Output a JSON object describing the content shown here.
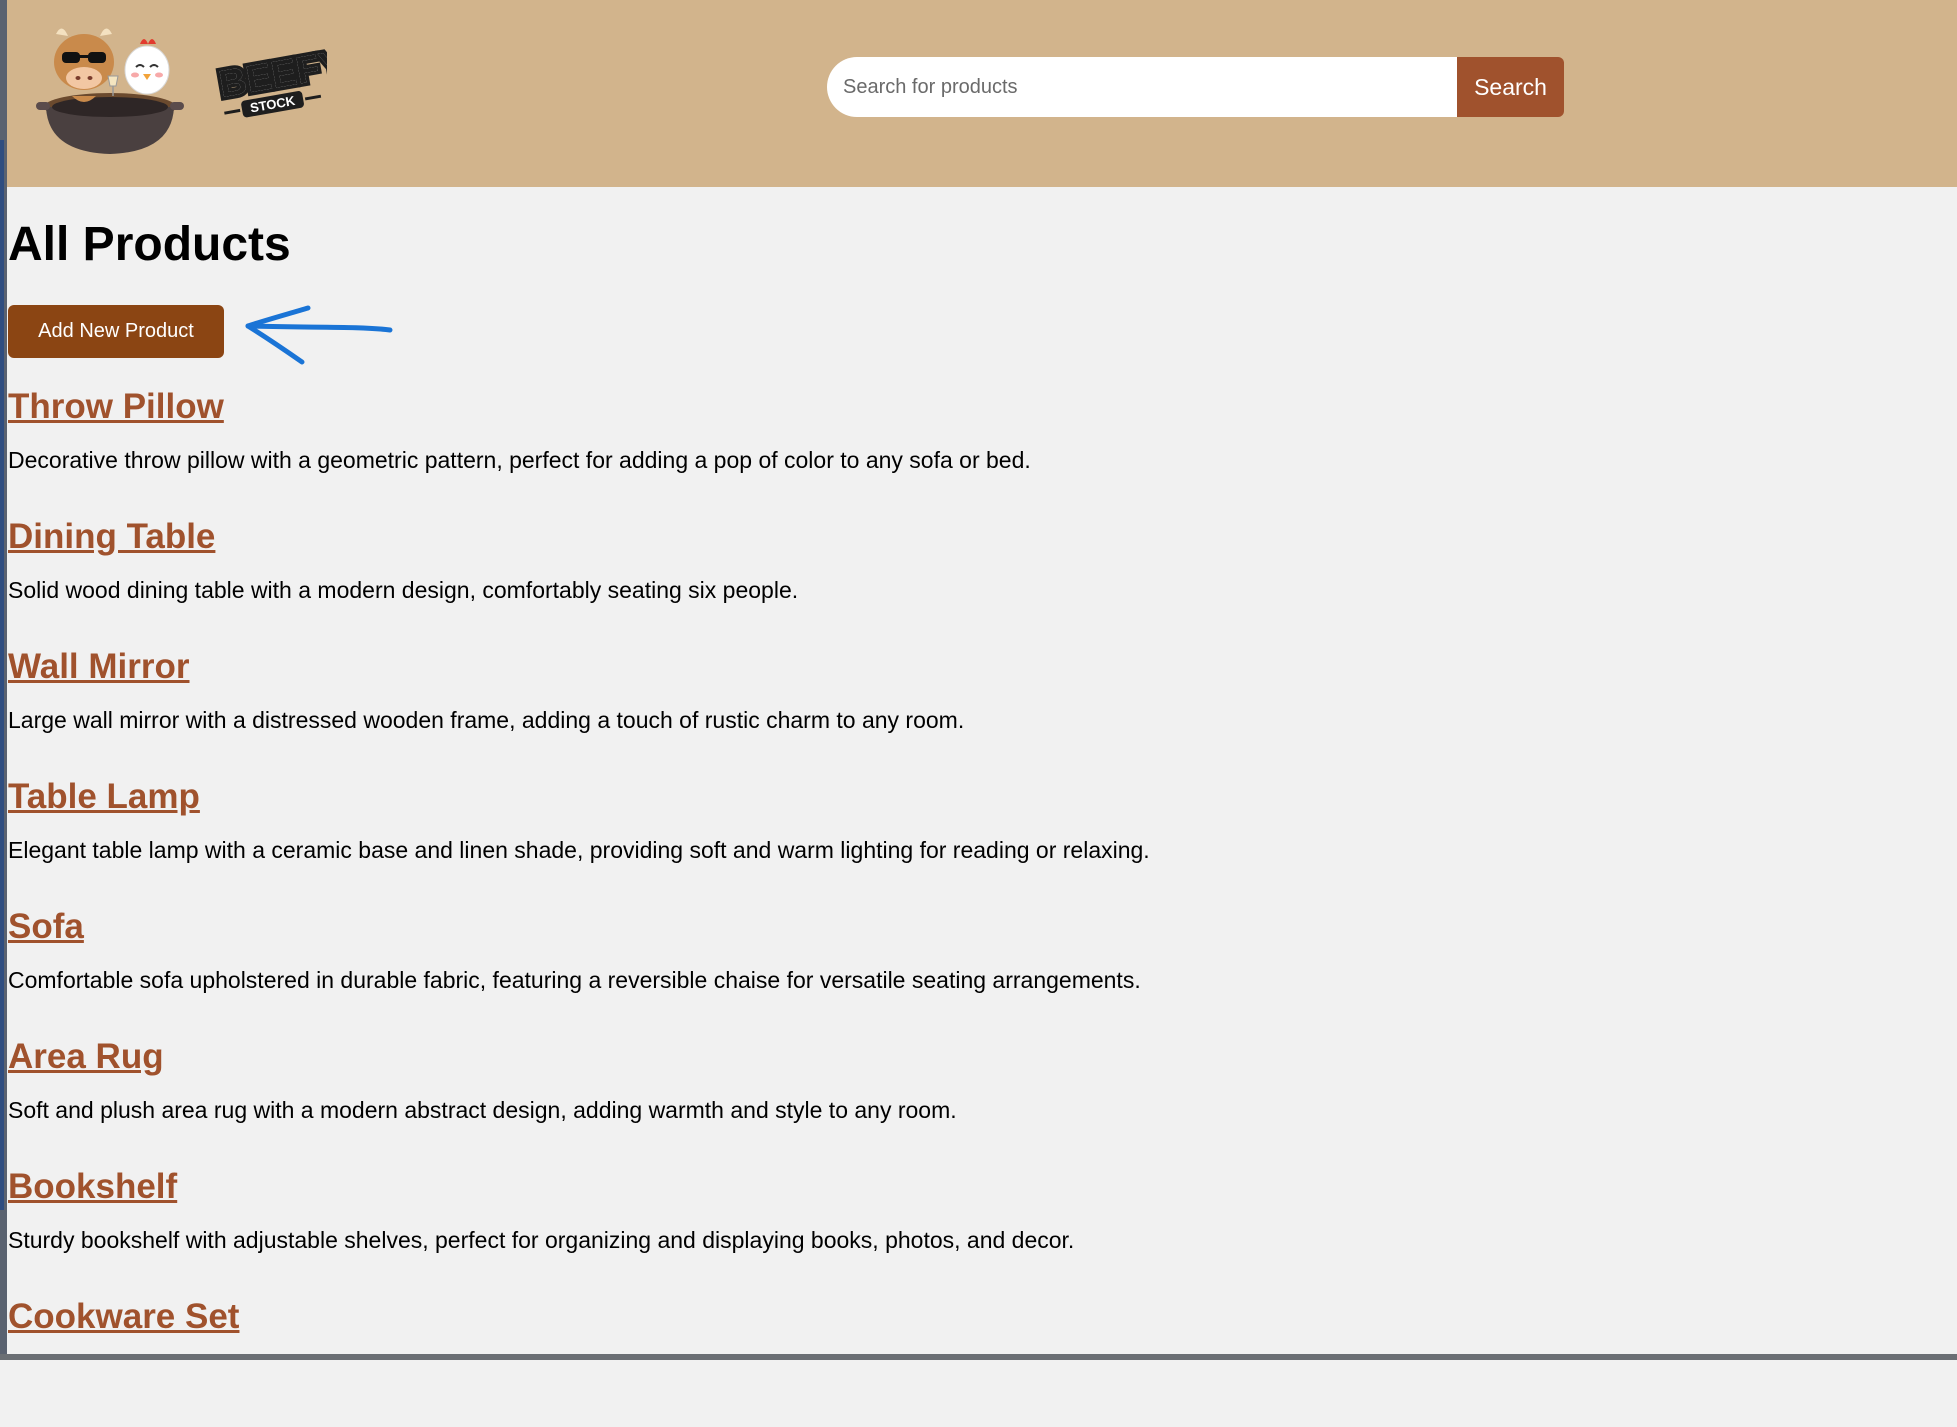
{
  "header": {
    "logo_text": "BEEFY STOCK",
    "search": {
      "placeholder": "Search for products",
      "value": "",
      "button_label": "Search"
    }
  },
  "main": {
    "title": "All Products",
    "add_button_label": "Add New Product",
    "products": [
      {
        "name": "Throw Pillow",
        "description": "Decorative throw pillow with a geometric pattern, perfect for adding a pop of color to any sofa or bed."
      },
      {
        "name": "Dining Table",
        "description": "Solid wood dining table with a modern design, comfortably seating six people."
      },
      {
        "name": "Wall Mirror",
        "description": "Large wall mirror with a distressed wooden frame, adding a touch of rustic charm to any room."
      },
      {
        "name": "Table Lamp",
        "description": "Elegant table lamp with a ceramic base and linen shade, providing soft and warm lighting for reading or relaxing."
      },
      {
        "name": "Sofa",
        "description": "Comfortable sofa upholstered in durable fabric, featuring a reversible chaise for versatile seating arrangements."
      },
      {
        "name": "Area Rug",
        "description": "Soft and plush area rug with a modern abstract design, adding warmth and style to any room."
      },
      {
        "name": "Bookshelf",
        "description": "Sturdy bookshelf with adjustable shelves, perfect for organizing and displaying books, photos, and decor."
      },
      {
        "name": "Cookware Set",
        "description": ""
      }
    ]
  },
  "colors": {
    "header_bg": "#d2b48c",
    "accent": "#a0522d",
    "add_button": "#8b4513",
    "annotation_arrow": "#1a74d6",
    "page_bg": "#f1f1f1"
  }
}
